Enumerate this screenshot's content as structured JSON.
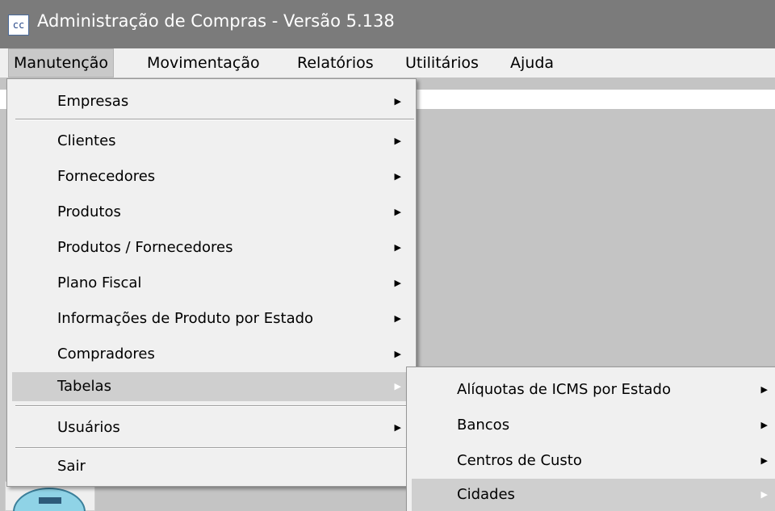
{
  "window": {
    "icon_text": "cc",
    "title": "Administração de Compras - Versão 5.138"
  },
  "menubar": [
    {
      "label": "Manutenção"
    },
    {
      "label": "Movimentação"
    },
    {
      "label": "Relatórios"
    },
    {
      "label": "Utilitários"
    },
    {
      "label": "Ajuda"
    }
  ],
  "dropdown": {
    "items": [
      {
        "label": "Empresas",
        "has_submenu": true
      },
      {
        "label": "Clientes",
        "has_submenu": true
      },
      {
        "label": "Fornecedores",
        "has_submenu": true
      },
      {
        "label": "Produtos",
        "has_submenu": true
      },
      {
        "label": "Produtos / Fornecedores",
        "has_submenu": true
      },
      {
        "label": "Plano Fiscal",
        "has_submenu": true
      },
      {
        "label": "Informações de Produto por Estado",
        "has_submenu": true
      },
      {
        "label": "Compradores",
        "has_submenu": true
      },
      {
        "label": "Tabelas",
        "has_submenu": true,
        "highlighted": true
      },
      {
        "label": "Usuários",
        "has_submenu": true
      },
      {
        "label": "Sair",
        "has_submenu": false
      }
    ]
  },
  "submenu": {
    "items": [
      {
        "label": "Alíquotas de ICMS por Estado",
        "has_submenu": true
      },
      {
        "label": "Bancos",
        "has_submenu": true
      },
      {
        "label": "Centros de Custo",
        "has_submenu": true
      },
      {
        "label": "Cidades",
        "has_submenu": true,
        "highlighted": true
      }
    ]
  },
  "colors": {
    "titlebar": "#7b7b7b",
    "menu_bg": "#f0f0f0",
    "highlight": "#cfcfcf"
  }
}
